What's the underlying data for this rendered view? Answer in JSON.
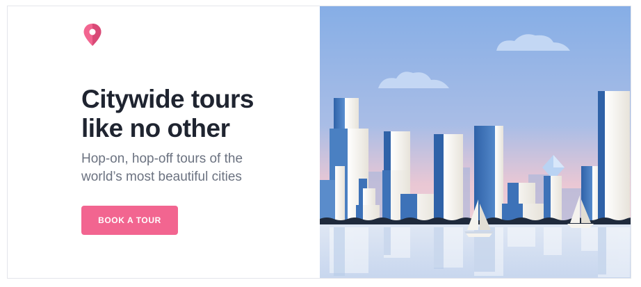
{
  "hero": {
    "headline_line1": "Citywide tours",
    "headline_line2": "like no other",
    "subtitle_line1": "Hop-on, hop-off tours of the",
    "subtitle_line2": "world’s most beautiful cities",
    "cta_label": "BOOK A TOUR"
  },
  "icons": {
    "logo": "map-pin-icon"
  },
  "colors": {
    "brand_pink": "#f26590",
    "headline": "#1f2430",
    "subtitle": "#6b7280",
    "sky_top": "#86aee6",
    "sky_bottom": "#e9c7d4",
    "building_blue": "#3d72b8",
    "building_white": "#f5f3ee"
  }
}
